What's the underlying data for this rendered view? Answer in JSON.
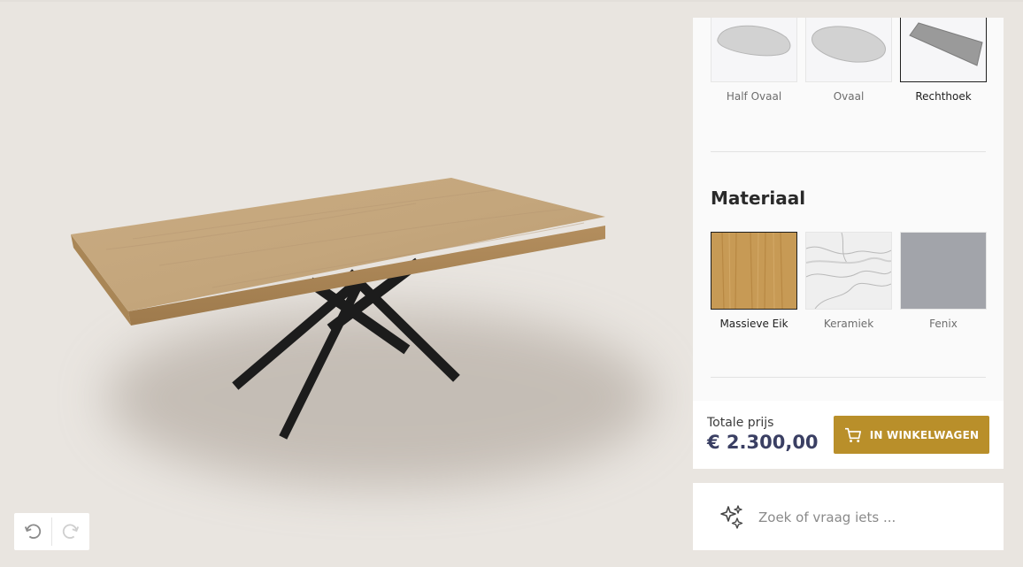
{
  "shapes": {
    "options": [
      {
        "label": "Half Ovaal",
        "selected": false
      },
      {
        "label": "Ovaal",
        "selected": false
      },
      {
        "label": "Rechthoek",
        "selected": true
      }
    ]
  },
  "material": {
    "title": "Materiaal",
    "options": [
      {
        "label": "Massieve Eik",
        "selected": true,
        "swatch_color": "#c79a55"
      },
      {
        "label": "Keramiek",
        "selected": false,
        "swatch_color": "#eeeeee"
      },
      {
        "label": "Fenix",
        "selected": false,
        "swatch_color": "#a2a4aa"
      }
    ]
  },
  "cart": {
    "total_label": "Totale prijs",
    "total_value": "€ 2.300,00",
    "button_label": "IN WINKELWAGEN",
    "accent_color": "#b98f2a"
  },
  "search": {
    "placeholder": "Zoek of vraag iets ..."
  },
  "toolbar": {
    "icons": [
      "undo-icon",
      "redo-icon"
    ]
  }
}
